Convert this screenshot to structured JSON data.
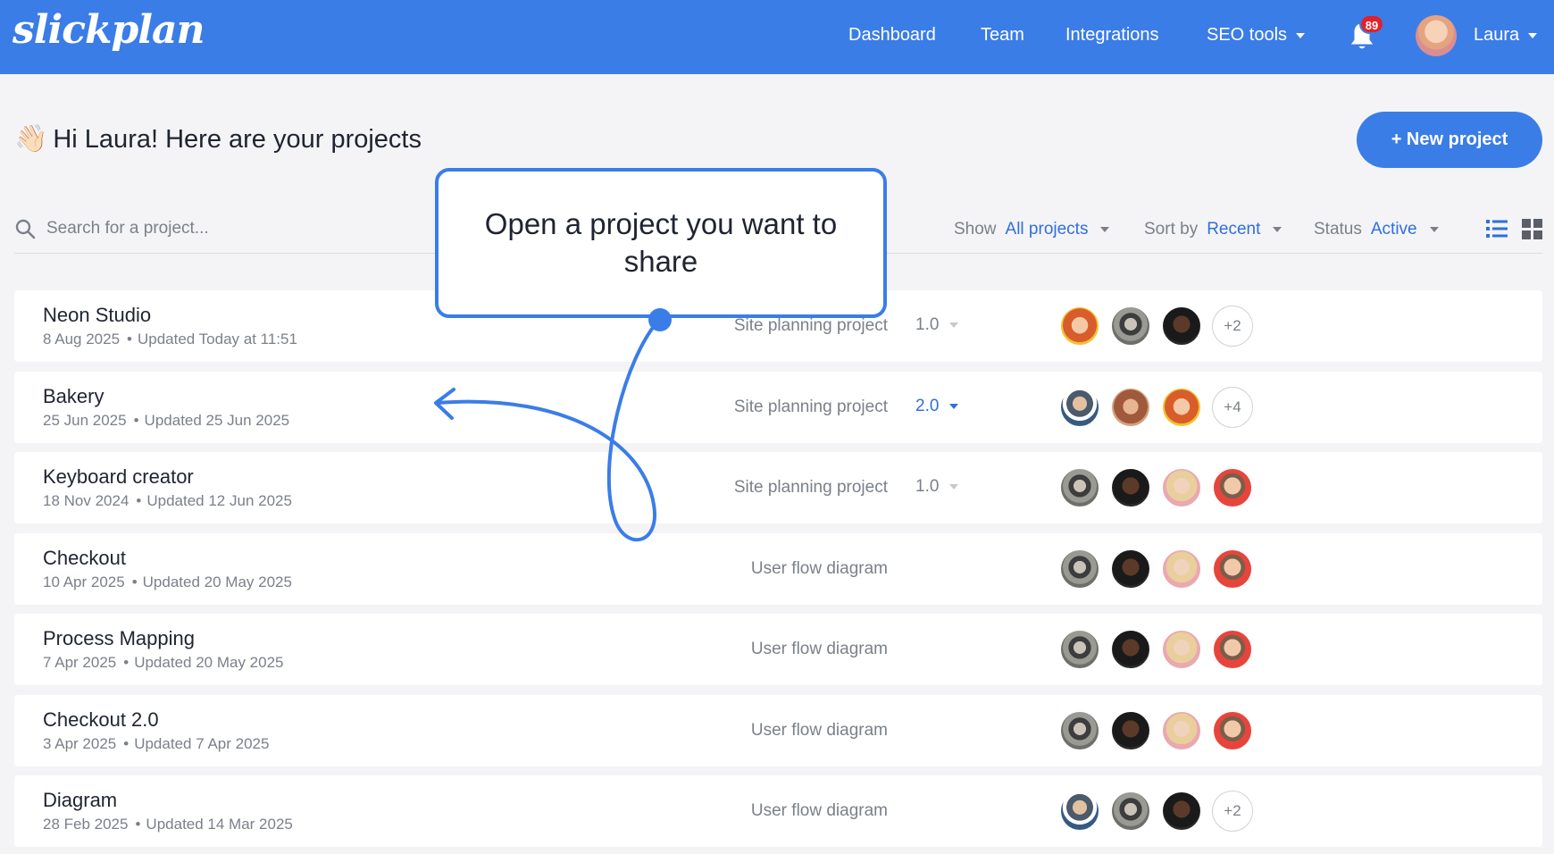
{
  "header": {
    "logo": "slickplan",
    "nav": [
      "Dashboard",
      "Team",
      "Integrations",
      "SEO tools"
    ],
    "notifications": "89",
    "user_name": "Laura"
  },
  "main": {
    "greeting": "Hi Laura! Here are your projects",
    "greeting_emoji": "👋🏻",
    "new_project_label": "+ New project",
    "search_placeholder": "Search for a project...",
    "filters": {
      "show_label": "Show",
      "show_value": "All projects",
      "sort_label": "Sort by",
      "sort_value": "Recent",
      "status_label": "Status",
      "status_value": "Active"
    }
  },
  "callout": {
    "text": "Open a project you want to share"
  },
  "projects": [
    {
      "name": "Neon Studio",
      "created": "8 Aug 2025",
      "updated": "Updated Today at 11:51",
      "type": "Site planning project",
      "version": "1.0",
      "more": "+2"
    },
    {
      "name": "Bakery",
      "created": "25 Jun 2025",
      "updated": "Updated 25 Jun 2025",
      "type": "Site planning project",
      "version": "2.0",
      "more": "+4"
    },
    {
      "name": "Keyboard creator",
      "created": "18 Nov 2024",
      "updated": "Updated 12 Jun 2025",
      "type": "Site planning project",
      "version": "1.0",
      "more": ""
    },
    {
      "name": "Checkout",
      "created": "10 Apr 2025",
      "updated": "Updated 20 May 2025",
      "type": "User flow diagram",
      "version": "",
      "more": ""
    },
    {
      "name": "Process Mapping",
      "created": "7 Apr 2025",
      "updated": "Updated 20 May 2025",
      "type": "User flow diagram",
      "version": "",
      "more": ""
    },
    {
      "name": "Checkout 2.0",
      "created": "3 Apr 2025",
      "updated": "Updated 7 Apr 2025",
      "type": "User flow diagram",
      "version": "",
      "more": ""
    },
    {
      "name": "Diagram",
      "created": "28 Feb 2025",
      "updated": "Updated 14 Mar 2025",
      "type": "User flow diagram",
      "version": "",
      "more": "+2"
    }
  ],
  "colors": {
    "brand": "#3b7de7",
    "accent_text": "#2f6fde",
    "badge": "#e3202b"
  }
}
